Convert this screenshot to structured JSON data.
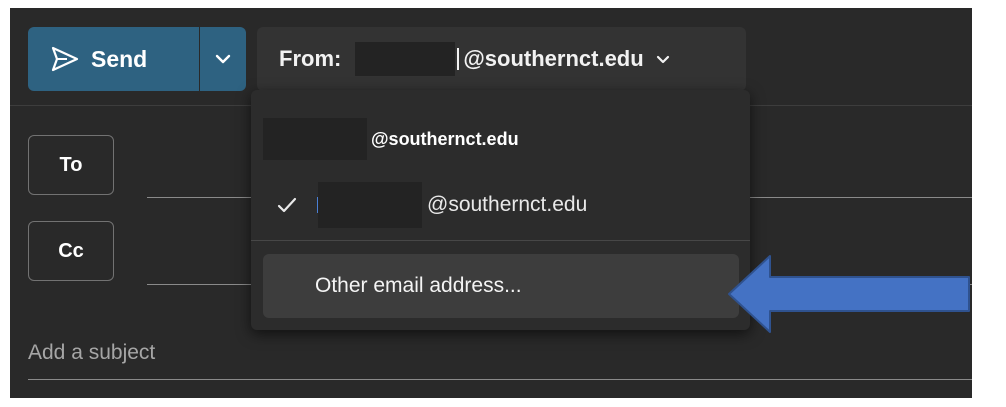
{
  "toolbar": {
    "send_label": "Send",
    "from_label": "From:",
    "from_domain": "@southernct.edu"
  },
  "recipients": {
    "to_label": "To",
    "cc_label": "Cc"
  },
  "subject": {
    "placeholder": "Add a subject"
  },
  "from_menu": {
    "options": [
      {
        "label": "@southernct.edu",
        "selected": false
      },
      {
        "label": "@southernct.edu",
        "selected": true
      },
      {
        "label": "Other email address..."
      }
    ]
  },
  "icons": {
    "send": "send-arrow-icon",
    "split": "chevron-down-icon",
    "from_chevron": "chevron-down-icon",
    "selected": "checkmark-icon",
    "annotation": "left-arrow-icon"
  },
  "colors": {
    "accent": "#2e6281",
    "background": "#292929",
    "annotation_arrow": "#4472c4"
  }
}
